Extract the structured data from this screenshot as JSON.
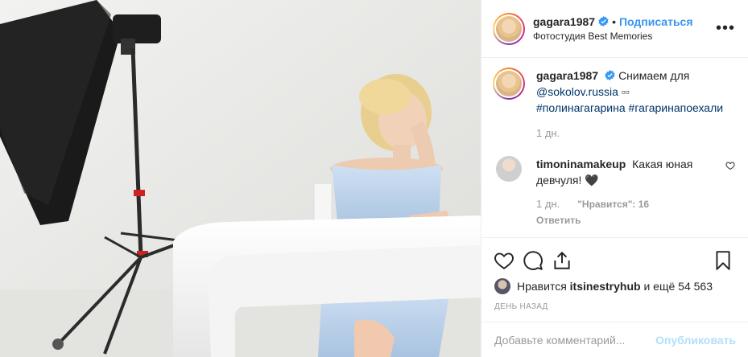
{
  "post": {
    "author": {
      "username": "gagara1987",
      "verified": true,
      "follow_label": "Подписаться",
      "separator": "•",
      "location": "Фотостудия Best Memories"
    },
    "more_label": "•••",
    "caption": {
      "username": "gagara1987",
      "text_before": "Снимаем для",
      "mention": "@sokolov.russia",
      "emoji": "▫▫",
      "hashtags": "#полинагагарина #гагаринапоехали",
      "time": "1 дн."
    },
    "comment": {
      "username": "timoninamakeup",
      "text": "Какая юная девчуля! 🖤",
      "time": "1 дн.",
      "likes": "\"Нравится\": 16",
      "reply_label": "Ответить"
    },
    "likes_line": {
      "prefix": "Нравится",
      "liker": "itsinestryhub",
      "suffix": "и ещё 54 563"
    },
    "date": "ДЕНЬ НАЗАД",
    "add_comment": {
      "placeholder": "Добавьте комментарий...",
      "publish_label": "Опубликовать"
    }
  },
  "colors": {
    "accent": "#3897f0",
    "muted": "#999999",
    "publish_disabled": "#b2dffc",
    "border": "#efefef"
  },
  "icons": [
    "verified-badge-icon",
    "more-icon",
    "heart-icon",
    "comment-icon",
    "share-icon",
    "bookmark-icon",
    "small-heart-icon"
  ]
}
